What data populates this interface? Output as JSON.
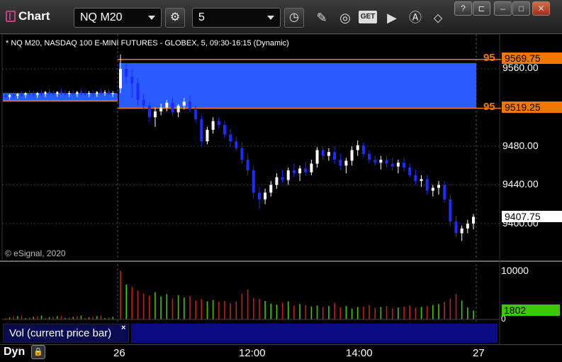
{
  "window": {
    "app_title": "Chart",
    "symbol": "NQ M20",
    "interval": "5",
    "get_label": "GET",
    "win_buttons": [
      "?",
      "⊏",
      "–",
      "□",
      "✕"
    ]
  },
  "legend": {
    "title": "* NQ M20, NASDAQ 100 E-MINI FUTURES - GLOBEX, 5, 09:30-16:15 (Dynamic)",
    "copyright": "© eSignal, 2020"
  },
  "price_axis": {
    "ticks": [
      "9560.00",
      "9480.00",
      "9440.00",
      "9400.00"
    ],
    "last_price": "9407.75"
  },
  "orders": [
    {
      "qty": "95",
      "price": "9569.75"
    },
    {
      "qty": "95",
      "price": "9519.25"
    }
  ],
  "volume": {
    "study_label": "Vol (current price bar)",
    "close_glyph": "×",
    "axis_max": "10000",
    "axis_min": "0",
    "last_value": "1802"
  },
  "time_axis": {
    "mode_label": "Dyn",
    "ticks": [
      "26",
      "12:00",
      "14:00",
      "27"
    ]
  },
  "colors": {
    "up": "#ffffff",
    "down": "#1a2cff",
    "order_line": "#f07800",
    "zone": "#2a5bff",
    "vol_up": "#3ec800",
    "vol_down": "#c81e14"
  },
  "chart_data": {
    "type": "candlestick",
    "title": "* NQ M20, NASDAQ 100 E-MINI FUTURES - GLOBEX, 5, 09:30-16:15 (Dynamic)",
    "ylim": [
      9380,
      9580
    ],
    "volume_ylim": [
      0,
      10000
    ],
    "x_labels": [
      "26",
      "12:00",
      "14:00",
      "27"
    ],
    "pre_session": [
      [
        9533,
        9536,
        9529,
        9531
      ],
      [
        9531,
        9534,
        9528,
        9533
      ],
      [
        9533,
        9536,
        9530,
        9532
      ],
      [
        9532,
        9535,
        9529,
        9534
      ],
      [
        9534,
        9537,
        9531,
        9533
      ],
      [
        9533,
        9536,
        9530,
        9535
      ],
      [
        9535,
        9538,
        9532,
        9534
      ],
      [
        9534,
        9537,
        9531,
        9533
      ],
      [
        9533,
        9536,
        9530,
        9535
      ],
      [
        9535,
        9538,
        9532,
        9534
      ],
      [
        9534,
        9537,
        9531,
        9536
      ],
      [
        9536,
        9539,
        9533,
        9535
      ],
      [
        9535,
        9538,
        9532,
        9534
      ],
      [
        9534,
        9537,
        9531,
        9536
      ],
      [
        9536,
        9539,
        9533,
        9535
      ],
      [
        9535,
        9538,
        9532,
        9534
      ],
      [
        9534,
        9537,
        9531,
        9535
      ],
      [
        9535,
        9538,
        9532,
        9534
      ],
      [
        9534,
        9537,
        9531,
        9536
      ],
      [
        9536,
        9539,
        9533,
        9535
      ],
      [
        9535,
        9538,
        9532,
        9534
      ],
      [
        9534,
        9537,
        9531,
        9535
      ],
      [
        9535,
        9538,
        9531,
        9534
      ],
      [
        9534,
        9537,
        9531,
        9536
      ],
      [
        9536,
        9539,
        9533,
        9535
      ],
      [
        9535,
        9538,
        9532,
        9536
      ],
      [
        9536,
        9539,
        9533,
        9534
      ],
      [
        9534,
        9537,
        9531,
        9535
      ]
    ],
    "candles": [
      [
        9540,
        9575,
        9535,
        9560
      ],
      [
        9560,
        9566,
        9545,
        9552
      ],
      [
        9552,
        9560,
        9530,
        9545
      ],
      [
        9545,
        9550,
        9522,
        9528
      ],
      [
        9528,
        9534,
        9518,
        9522
      ],
      [
        9522,
        9526,
        9505,
        9510
      ],
      [
        9510,
        9520,
        9500,
        9516
      ],
      [
        9516,
        9524,
        9512,
        9520
      ],
      [
        9520,
        9528,
        9516,
        9525
      ],
      [
        9525,
        9530,
        9512,
        9515
      ],
      [
        9515,
        9524,
        9510,
        9522
      ],
      [
        9522,
        9530,
        9518,
        9526
      ],
      [
        9526,
        9532,
        9515,
        9518
      ],
      [
        9518,
        9522,
        9504,
        9508
      ],
      [
        9508,
        9512,
        9480,
        9485
      ],
      [
        9485,
        9500,
        9482,
        9497
      ],
      [
        9497,
        9510,
        9493,
        9506
      ],
      [
        9506,
        9510,
        9498,
        9502
      ],
      [
        9502,
        9506,
        9488,
        9492
      ],
      [
        9492,
        9498,
        9480,
        9485
      ],
      [
        9485,
        9490,
        9475,
        9478
      ],
      [
        9478,
        9484,
        9462,
        9466
      ],
      [
        9466,
        9472,
        9450,
        9455
      ],
      [
        9455,
        9460,
        9426,
        9432
      ],
      [
        9432,
        9438,
        9415,
        9425
      ],
      [
        9425,
        9436,
        9420,
        9432
      ],
      [
        9432,
        9444,
        9428,
        9440
      ],
      [
        9440,
        9452,
        9436,
        9448
      ],
      [
        9448,
        9456,
        9442,
        9445
      ],
      [
        9445,
        9458,
        9440,
        9455
      ],
      [
        9455,
        9462,
        9448,
        9452
      ],
      [
        9452,
        9460,
        9444,
        9457
      ],
      [
        9457,
        9464,
        9449,
        9453
      ],
      [
        9453,
        9466,
        9450,
        9462
      ],
      [
        9462,
        9479,
        9458,
        9476
      ],
      [
        9476,
        9480,
        9466,
        9470
      ],
      [
        9470,
        9478,
        9465,
        9474
      ],
      [
        9474,
        9480,
        9462,
        9466
      ],
      [
        9466,
        9472,
        9455,
        9460
      ],
      [
        9460,
        9468,
        9452,
        9465
      ],
      [
        9465,
        9480,
        9460,
        9476
      ],
      [
        9476,
        9486,
        9470,
        9481
      ],
      [
        9481,
        9484,
        9468,
        9472
      ],
      [
        9472,
        9476,
        9462,
        9466
      ],
      [
        9466,
        9470,
        9460,
        9463
      ],
      [
        9463,
        9470,
        9456,
        9466
      ],
      [
        9466,
        9470,
        9458,
        9462
      ],
      [
        9462,
        9468,
        9455,
        9459
      ],
      [
        9459,
        9466,
        9452,
        9463
      ],
      [
        9463,
        9468,
        9454,
        9458
      ],
      [
        9458,
        9462,
        9448,
        9450
      ],
      [
        9450,
        9456,
        9440,
        9444
      ],
      [
        9444,
        9450,
        9438,
        9446
      ],
      [
        9446,
        9450,
        9430,
        9434
      ],
      [
        9434,
        9440,
        9428,
        9437
      ],
      [
        9437,
        9444,
        9430,
        9440
      ],
      [
        9440,
        9444,
        9422,
        9425
      ],
      [
        9425,
        9430,
        9398,
        9402
      ],
      [
        9402,
        9408,
        9386,
        9390
      ],
      [
        9390,
        9398,
        9382,
        9395
      ],
      [
        9395,
        9404,
        9390,
        9400
      ],
      [
        9400,
        9410,
        9394,
        9407
      ]
    ],
    "volume": [
      9800,
      7000,
      6500,
      5800,
      5200,
      4800,
      5500,
      4600,
      5100,
      4200,
      4900,
      4400,
      4700,
      3800,
      4100,
      3600,
      3900,
      3500,
      3700,
      3300,
      3600,
      5200,
      6000,
      4300,
      4100,
      3700,
      3200,
      3000,
      3400,
      3600,
      2800,
      3100,
      2900,
      2600,
      2800,
      2500,
      2700,
      3300,
      2400,
      2700,
      2200,
      2500,
      2600,
      2900,
      2300,
      2500,
      2700,
      2200,
      2400,
      2600,
      2800,
      2300,
      2500,
      2700,
      2900,
      3100,
      3500,
      4200,
      5100,
      3800,
      2400,
      1802
    ],
    "volume_up": [
      false,
      true,
      false,
      false,
      false,
      false,
      true,
      true,
      true,
      false,
      true,
      true,
      false,
      false,
      false,
      true,
      true,
      false,
      false,
      false,
      false,
      false,
      false,
      false,
      false,
      true,
      true,
      true,
      false,
      true,
      false,
      true,
      false,
      true,
      true,
      false,
      true,
      false,
      false,
      true,
      true,
      true,
      false,
      false,
      false,
      true,
      false,
      false,
      true,
      false,
      false,
      false,
      true,
      false,
      true,
      true,
      false,
      false,
      false,
      true,
      true,
      true
    ],
    "orders": [
      9569.75,
      9519.25
    ],
    "last": 9407.75
  }
}
